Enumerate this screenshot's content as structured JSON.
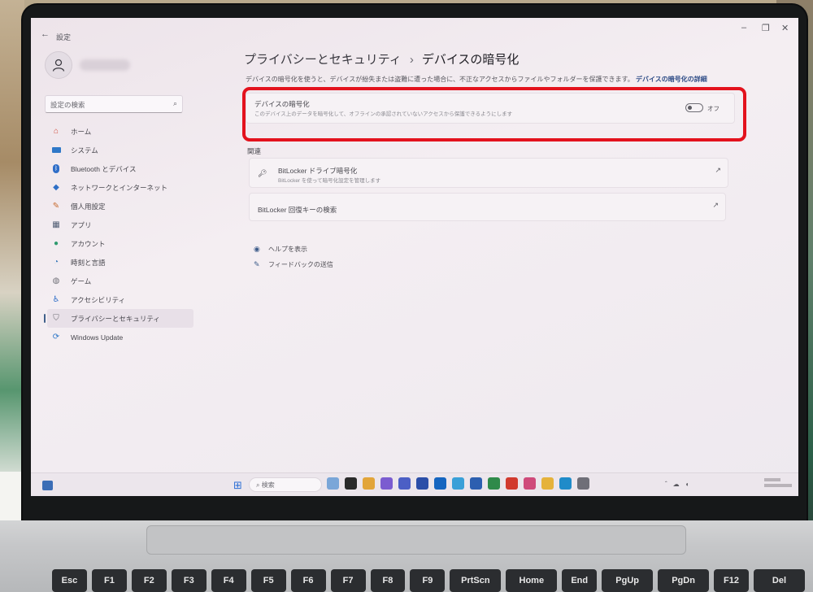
{
  "window": {
    "title": "設定",
    "back_label": "←"
  },
  "sidebar": {
    "search_placeholder": "設定の検索",
    "items": [
      {
        "label": "ホーム",
        "icon": "home-icon"
      },
      {
        "label": "システム",
        "icon": "monitor-icon"
      },
      {
        "label": "Bluetooth とデバイス",
        "icon": "bluetooth-icon"
      },
      {
        "label": "ネットワークとインターネット",
        "icon": "wifi-icon"
      },
      {
        "label": "個人用設定",
        "icon": "brush-icon"
      },
      {
        "label": "アプリ",
        "icon": "apps-icon"
      },
      {
        "label": "アカウント",
        "icon": "person-icon"
      },
      {
        "label": "時刻と言語",
        "icon": "globe-clock-icon"
      },
      {
        "label": "ゲーム",
        "icon": "gamepad-icon"
      },
      {
        "label": "アクセシビリティ",
        "icon": "accessibility-icon"
      },
      {
        "label": "プライバシーとセキュリティ",
        "icon": "shield-icon",
        "active": true
      },
      {
        "label": "Windows Update",
        "icon": "update-icon"
      }
    ]
  },
  "main": {
    "breadcrumb_parent": "プライバシーとセキュリティ",
    "breadcrumb_separator": "›",
    "breadcrumb_current": "デバイスの暗号化",
    "description": "デバイスの暗号化を使うと、デバイスが紛失または盗難に遭った場合に、不正なアクセスからファイルやフォルダーを保護できます。",
    "description_link": "デバイスの暗号化の詳細",
    "encryption_card": {
      "title": "デバイスの暗号化",
      "subtitle": "このデバイス上のデータを暗号化して、オフラインの承認されていないアクセスから保護できるようにします",
      "toggle_state": "オフ",
      "toggle_on": false
    },
    "related_heading": "関連",
    "related": [
      {
        "title": "BitLocker ドライブ暗号化",
        "subtitle": "BitLocker を使って暗号化設定を管理します",
        "icon": "key-icon"
      },
      {
        "title": "BitLocker 回復キーの検索",
        "subtitle": ""
      }
    ],
    "help_links": [
      {
        "label": "ヘルプを表示",
        "icon": "help-icon"
      },
      {
        "label": "フィードバックの送信",
        "icon": "feedback-icon"
      }
    ]
  },
  "taskbar": {
    "search_label": "検索"
  },
  "keyboard": {
    "keys": [
      "Esc",
      "F1",
      "F2",
      "F3",
      "F4",
      "F5",
      "F6",
      "F7",
      "F8",
      "F9",
      "PrtScn",
      "Home",
      "End",
      "PgUp",
      "PgDn",
      "F12",
      "Del"
    ]
  },
  "colors": {
    "highlight": "#e3121d",
    "accent": "#40608a",
    "link": "#2d4b86"
  }
}
